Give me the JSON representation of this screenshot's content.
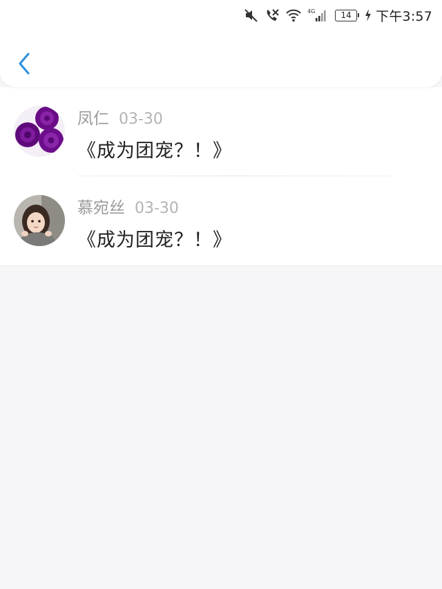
{
  "status_bar": {
    "network_label": "4G",
    "battery_level": "14",
    "time": "下午3:57"
  },
  "nav": {
    "back_icon": "chevron-left-icon",
    "accent_color": "#2b8fde"
  },
  "comments": [
    {
      "author": "凤仁",
      "date": "03-30",
      "text": "《成为团宠？！》",
      "avatar": "purple-roses-avatar"
    },
    {
      "author": "慕宛丝",
      "date": "03-30",
      "text": "《成为团宠？！》",
      "avatar": "girl-photo-avatar"
    }
  ]
}
